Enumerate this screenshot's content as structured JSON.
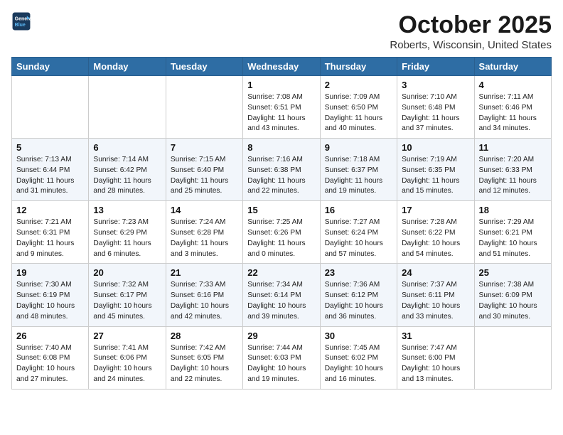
{
  "header": {
    "logo_line1": "General",
    "logo_line2": "Blue",
    "month_title": "October 2025",
    "subtitle": "Roberts, Wisconsin, United States"
  },
  "days_of_week": [
    "Sunday",
    "Monday",
    "Tuesday",
    "Wednesday",
    "Thursday",
    "Friday",
    "Saturday"
  ],
  "weeks": [
    [
      {
        "day": "",
        "info": ""
      },
      {
        "day": "",
        "info": ""
      },
      {
        "day": "",
        "info": ""
      },
      {
        "day": "1",
        "info": "Sunrise: 7:08 AM\nSunset: 6:51 PM\nDaylight: 11 hours\nand 43 minutes."
      },
      {
        "day": "2",
        "info": "Sunrise: 7:09 AM\nSunset: 6:50 PM\nDaylight: 11 hours\nand 40 minutes."
      },
      {
        "day": "3",
        "info": "Sunrise: 7:10 AM\nSunset: 6:48 PM\nDaylight: 11 hours\nand 37 minutes."
      },
      {
        "day": "4",
        "info": "Sunrise: 7:11 AM\nSunset: 6:46 PM\nDaylight: 11 hours\nand 34 minutes."
      }
    ],
    [
      {
        "day": "5",
        "info": "Sunrise: 7:13 AM\nSunset: 6:44 PM\nDaylight: 11 hours\nand 31 minutes."
      },
      {
        "day": "6",
        "info": "Sunrise: 7:14 AM\nSunset: 6:42 PM\nDaylight: 11 hours\nand 28 minutes."
      },
      {
        "day": "7",
        "info": "Sunrise: 7:15 AM\nSunset: 6:40 PM\nDaylight: 11 hours\nand 25 minutes."
      },
      {
        "day": "8",
        "info": "Sunrise: 7:16 AM\nSunset: 6:38 PM\nDaylight: 11 hours\nand 22 minutes."
      },
      {
        "day": "9",
        "info": "Sunrise: 7:18 AM\nSunset: 6:37 PM\nDaylight: 11 hours\nand 19 minutes."
      },
      {
        "day": "10",
        "info": "Sunrise: 7:19 AM\nSunset: 6:35 PM\nDaylight: 11 hours\nand 15 minutes."
      },
      {
        "day": "11",
        "info": "Sunrise: 7:20 AM\nSunset: 6:33 PM\nDaylight: 11 hours\nand 12 minutes."
      }
    ],
    [
      {
        "day": "12",
        "info": "Sunrise: 7:21 AM\nSunset: 6:31 PM\nDaylight: 11 hours\nand 9 minutes."
      },
      {
        "day": "13",
        "info": "Sunrise: 7:23 AM\nSunset: 6:29 PM\nDaylight: 11 hours\nand 6 minutes."
      },
      {
        "day": "14",
        "info": "Sunrise: 7:24 AM\nSunset: 6:28 PM\nDaylight: 11 hours\nand 3 minutes."
      },
      {
        "day": "15",
        "info": "Sunrise: 7:25 AM\nSunset: 6:26 PM\nDaylight: 11 hours\nand 0 minutes."
      },
      {
        "day": "16",
        "info": "Sunrise: 7:27 AM\nSunset: 6:24 PM\nDaylight: 10 hours\nand 57 minutes."
      },
      {
        "day": "17",
        "info": "Sunrise: 7:28 AM\nSunset: 6:22 PM\nDaylight: 10 hours\nand 54 minutes."
      },
      {
        "day": "18",
        "info": "Sunrise: 7:29 AM\nSunset: 6:21 PM\nDaylight: 10 hours\nand 51 minutes."
      }
    ],
    [
      {
        "day": "19",
        "info": "Sunrise: 7:30 AM\nSunset: 6:19 PM\nDaylight: 10 hours\nand 48 minutes."
      },
      {
        "day": "20",
        "info": "Sunrise: 7:32 AM\nSunset: 6:17 PM\nDaylight: 10 hours\nand 45 minutes."
      },
      {
        "day": "21",
        "info": "Sunrise: 7:33 AM\nSunset: 6:16 PM\nDaylight: 10 hours\nand 42 minutes."
      },
      {
        "day": "22",
        "info": "Sunrise: 7:34 AM\nSunset: 6:14 PM\nDaylight: 10 hours\nand 39 minutes."
      },
      {
        "day": "23",
        "info": "Sunrise: 7:36 AM\nSunset: 6:12 PM\nDaylight: 10 hours\nand 36 minutes."
      },
      {
        "day": "24",
        "info": "Sunrise: 7:37 AM\nSunset: 6:11 PM\nDaylight: 10 hours\nand 33 minutes."
      },
      {
        "day": "25",
        "info": "Sunrise: 7:38 AM\nSunset: 6:09 PM\nDaylight: 10 hours\nand 30 minutes."
      }
    ],
    [
      {
        "day": "26",
        "info": "Sunrise: 7:40 AM\nSunset: 6:08 PM\nDaylight: 10 hours\nand 27 minutes."
      },
      {
        "day": "27",
        "info": "Sunrise: 7:41 AM\nSunset: 6:06 PM\nDaylight: 10 hours\nand 24 minutes."
      },
      {
        "day": "28",
        "info": "Sunrise: 7:42 AM\nSunset: 6:05 PM\nDaylight: 10 hours\nand 22 minutes."
      },
      {
        "day": "29",
        "info": "Sunrise: 7:44 AM\nSunset: 6:03 PM\nDaylight: 10 hours\nand 19 minutes."
      },
      {
        "day": "30",
        "info": "Sunrise: 7:45 AM\nSunset: 6:02 PM\nDaylight: 10 hours\nand 16 minutes."
      },
      {
        "day": "31",
        "info": "Sunrise: 7:47 AM\nSunset: 6:00 PM\nDaylight: 10 hours\nand 13 minutes."
      },
      {
        "day": "",
        "info": ""
      }
    ]
  ]
}
